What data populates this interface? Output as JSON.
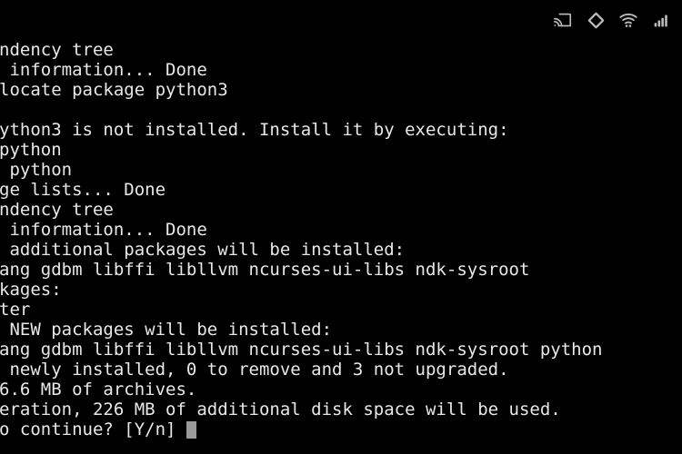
{
  "status_bar": {
    "icons": [
      {
        "name": "cast-icon",
        "label": "Screen cast"
      },
      {
        "name": "rhombus-app-icon",
        "label": "App indicator"
      },
      {
        "name": "wifi-icon",
        "label": "Wi-Fi"
      },
      {
        "name": "cellular-signal-icon",
        "label": "Signal strength"
      }
    ],
    "colors": {
      "icon": "#bdbdbd",
      "background": "#000000"
    }
  },
  "terminal": {
    "colors": {
      "background": "#000000",
      "foreground": "#e8e8e8",
      "cursor": "#9a9a9a"
    },
    "lines": [
      "ndency tree",
      " information... Done",
      "locate package python3",
      "",
      "ython3 is not installed. Install it by executing:",
      "python",
      " python",
      "ge lists... Done",
      "ndency tree",
      " information... Done",
      " additional packages will be installed:",
      "ang gdbm libffi libllvm ncurses-ui-libs ndk-sysroot",
      "kages:",
      "ter",
      " NEW packages will be installed:",
      "ang gdbm libffi libllvm ncurses-ui-libs ndk-sysroot python",
      " newly installed, 0 to remove and 3 not upgraded.",
      "6.6 MB of archives.",
      "eration, 226 MB of additional disk space will be used.",
      "o continue? [Y/n] "
    ],
    "prompt_text": "o continue? [Y/n] ",
    "cursor_visible": true
  }
}
